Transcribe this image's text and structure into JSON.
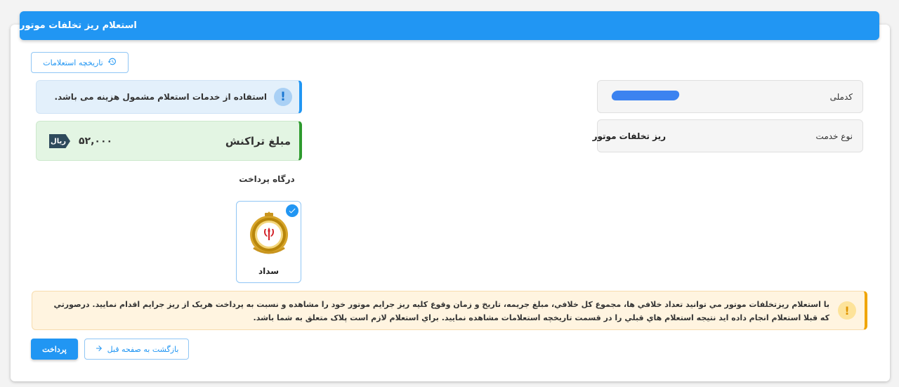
{
  "header": {
    "title": "استعلام ریز تخلفات موتور"
  },
  "toolbar": {
    "history_label": "تاریخچه استعلامات",
    "history_icon": "history-icon"
  },
  "fields": {
    "national_code": {
      "label": "کدملی",
      "value": ""
    },
    "service_type": {
      "label": "نوع خدمت",
      "value": "ریز تخلفات موتور"
    }
  },
  "info": {
    "text": "استفاده از خدمات استعلام مشمول هزینه می باشد.",
    "icon": "!"
  },
  "amount": {
    "title": "مبلغ تراکنش",
    "value": "۵۲,۰۰۰",
    "currency": "ریال"
  },
  "gateway": {
    "title": "درگاه پرداخت",
    "selected": "سداد"
  },
  "warning": {
    "icon": "!",
    "text": "با استعلام ریزتخلفات موتور مي توانيد تعداد خلافي ها، مجموع کل خلافي، مبلغ جريمه، تاريخ و زمان وقوع کليه ريز جرايم موتور خود را مشاهده و نسبت به پرداخت هريک از ريز جرايم اقدام نماييد. درصورتي که قبلا استعلام انجام داده ايد نتيجه استعلام هاي قبلي را در قسمت تاريخچه استعلامات مشاهده نماييد. براي استعلام لازم است پلاک متعلق به شما باشد."
  },
  "actions": {
    "pay_label": "پرداخت",
    "back_label": "بازگشت به صفحه قبل"
  },
  "colors": {
    "primary": "#2196f3",
    "success": "#2e9a2e",
    "warning": "#f0a500"
  }
}
